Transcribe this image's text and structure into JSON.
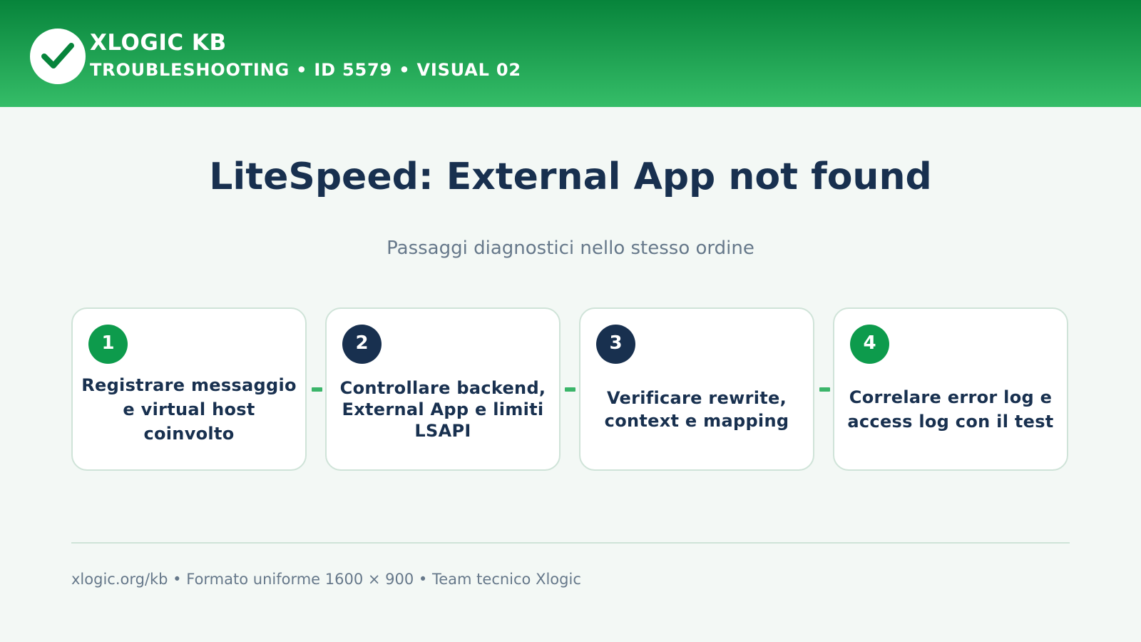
{
  "header": {
    "brand": "XLOGIC KB",
    "subtitle": "TROUBLESHOOTING • ID 5579 • VISUAL 02",
    "logo_icon": "checkmark-icon",
    "colors": {
      "gradient_top": "#07843b",
      "gradient_bottom": "#35bd68"
    }
  },
  "main": {
    "title": "LiteSpeed: External App not found",
    "subtitle": "Passaggi diagnostici nello stesso ordine"
  },
  "steps": [
    {
      "number": "1",
      "text": "Registrare messaggio e virtual host coinvolto",
      "badge_color": "#0d9b4c"
    },
    {
      "number": "2",
      "text": "Controllare backend, External App e limiti LSAPI",
      "badge_color": "#18304f"
    },
    {
      "number": "3",
      "text": "Verificare rewrite, context e mapping",
      "badge_color": "#18304f"
    },
    {
      "number": "4",
      "text": "Correlare error log e access log con il test",
      "badge_color": "#0d9b4c"
    }
  ],
  "footer": {
    "text": "xlogic.org/kb • Formato uniforme 1600 × 900 • Team tecnico Xlogic"
  },
  "colors": {
    "background": "#f3f8f5",
    "text_dark": "#18304f",
    "text_muted": "#66788a",
    "accent_green": "#3bb56a",
    "card_border": "#cfe3d8"
  }
}
